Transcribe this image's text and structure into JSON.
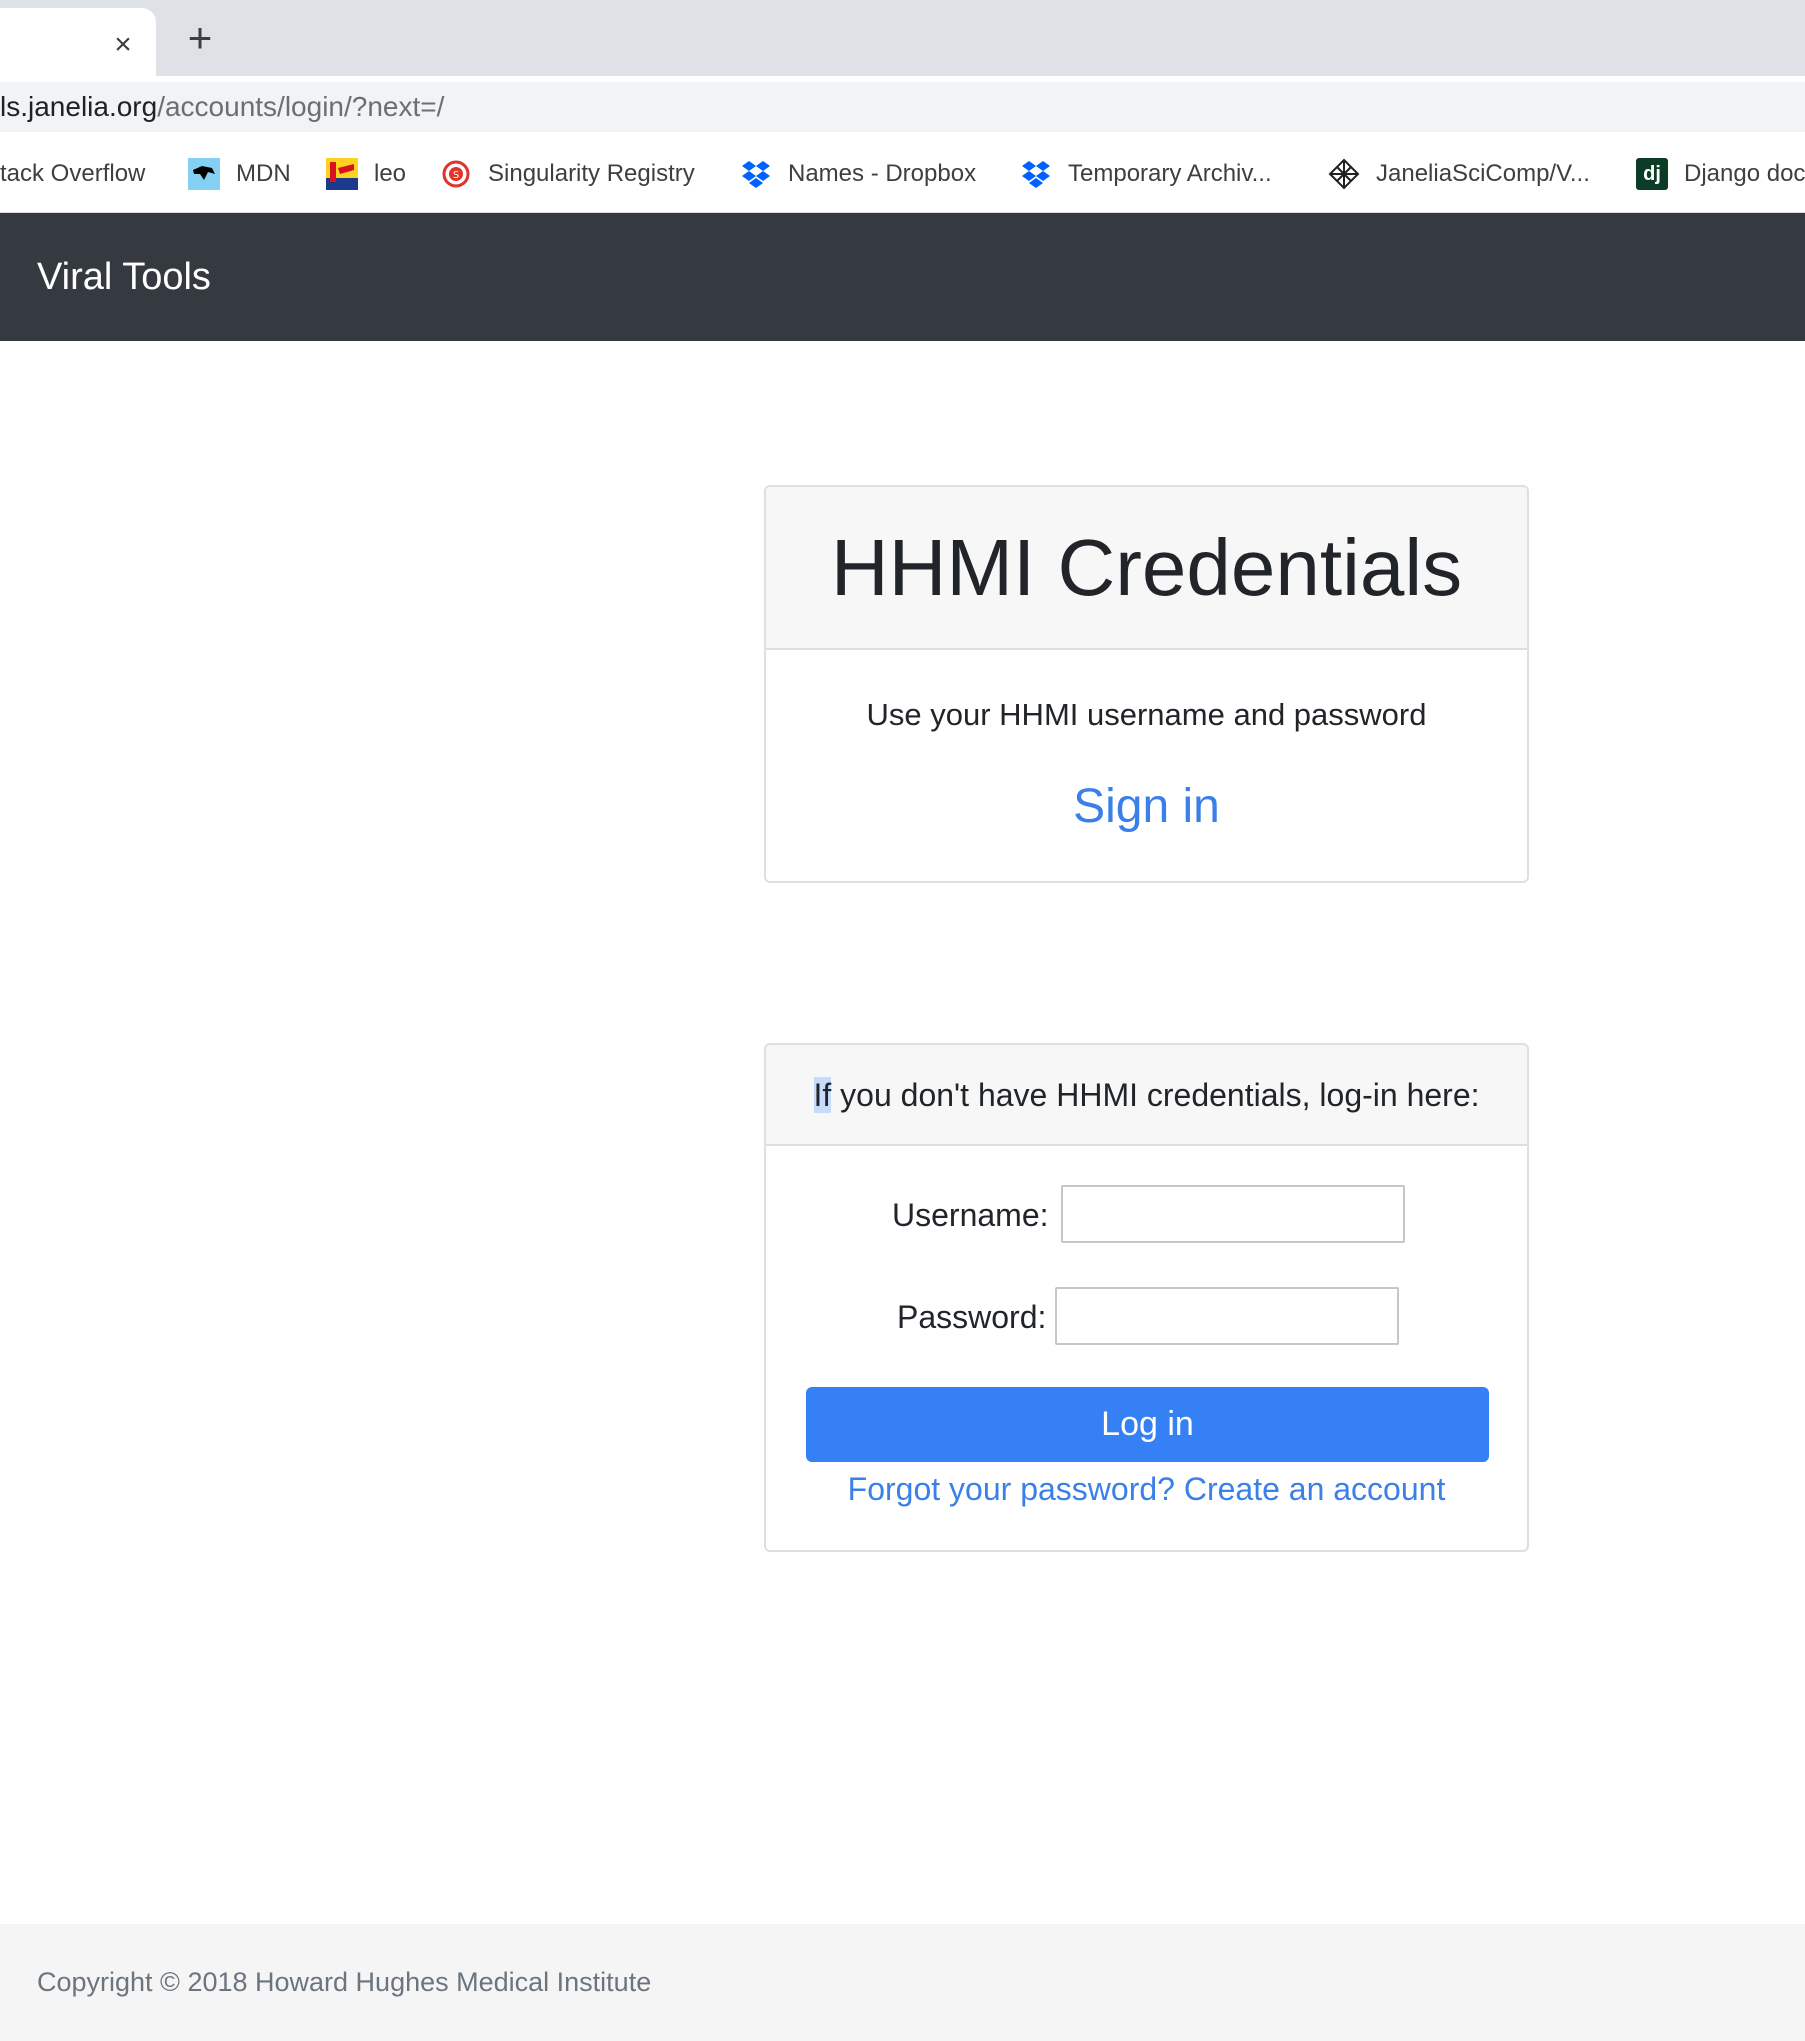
{
  "browser": {
    "tab_close_glyph": "×",
    "new_tab_glyph": "+",
    "url_host": "ls.janelia.org",
    "url_path": "/accounts/login/?next=/",
    "bookmarks": [
      {
        "label": "tack Overflow",
        "icon": "none"
      },
      {
        "label": "MDN",
        "icon": "mdn-icon"
      },
      {
        "label": "leo",
        "icon": "leo-icon"
      },
      {
        "label": "Singularity Registry",
        "icon": "singularity-icon"
      },
      {
        "label": "Names - Dropbox",
        "icon": "dropbox-icon"
      },
      {
        "label": "Temporary Archiv...",
        "icon": "dropbox-icon"
      },
      {
        "label": "JaneliaSciComp/V...",
        "icon": "github-diamond-icon"
      },
      {
        "label": "Django doc",
        "icon": "django-icon"
      }
    ],
    "django_icon_text": "dj"
  },
  "navbar": {
    "brand": "Viral Tools"
  },
  "hhmi_card": {
    "title": "HHMI Credentials",
    "description": "Use your HHMI username and password",
    "signin_label": "Sign in"
  },
  "local_card": {
    "header_selected": "If",
    "header_rest": " you don't have HHMI credentials, log-in here:",
    "username_label": "Username:",
    "username_value": "",
    "password_label": "Password:",
    "password_value": "",
    "login_button": "Log in",
    "forgot_link": "Forgot your password?",
    "create_link": "Create an account"
  },
  "footer": {
    "copyright": "Copyright © 2018 Howard Hughes Medical Institute"
  },
  "colors": {
    "navbar_bg": "#343a40",
    "link": "#3a80e8",
    "primary_button": "#3680f5",
    "dropbox": "#0061fe"
  }
}
